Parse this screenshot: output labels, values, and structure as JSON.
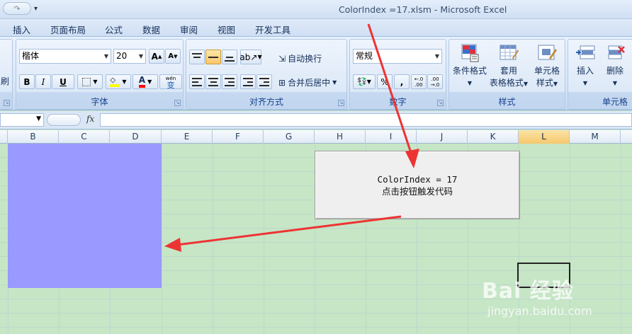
{
  "window": {
    "title": "ColorIndex =17.xlsm - Microsoft Excel",
    "redo_glyph": "↷",
    "qat_dropdown": "▾"
  },
  "tabs": [
    "插入",
    "页面布局",
    "公式",
    "数据",
    "审阅",
    "视图",
    "开发工具"
  ],
  "ribbon": {
    "font": {
      "name": "楷体",
      "size": "20",
      "grow_label": "A",
      "shrink_label": "A",
      "bold": "B",
      "italic": "I",
      "underline": "U",
      "font_color_letter": "A",
      "phonetic_label": "wén",
      "phonetic_char": "变",
      "group_label": "字体"
    },
    "alignment": {
      "wrap_label": "自动换行",
      "merge_label": "合并后居中",
      "group_label": "对齐方式"
    },
    "number": {
      "format": "常规",
      "percent": "%",
      "comma": ",",
      "inc_decimal": "←.0 .00",
      "dec_decimal": ".00 →.0",
      "group_label": "数字"
    },
    "styles": {
      "conditional_label": "条件格式",
      "table_label_1": "套用",
      "table_label_2": "表格格式",
      "cell_style_label_1": "单元格",
      "cell_style_label_2": "样式",
      "group_label": "样式"
    },
    "cells": {
      "insert_label": "插入",
      "delete_label": "删除",
      "group_label": "单元格"
    },
    "left_partial_label": "刷"
  },
  "formula_bar": {
    "fx_label": "fx",
    "value": ""
  },
  "columns": [
    "B",
    "C",
    "D",
    "E",
    "F",
    "G",
    "H",
    "I",
    "J",
    "K",
    "L",
    "M"
  ],
  "selected_column": "L",
  "macro_button": {
    "line1": "ColorIndex = 17",
    "line2": "点击按钮触发代码"
  },
  "fill_color": "#9999ff",
  "watermark": {
    "text": "Bai 经验",
    "url": "jingyan.baidu.com"
  }
}
